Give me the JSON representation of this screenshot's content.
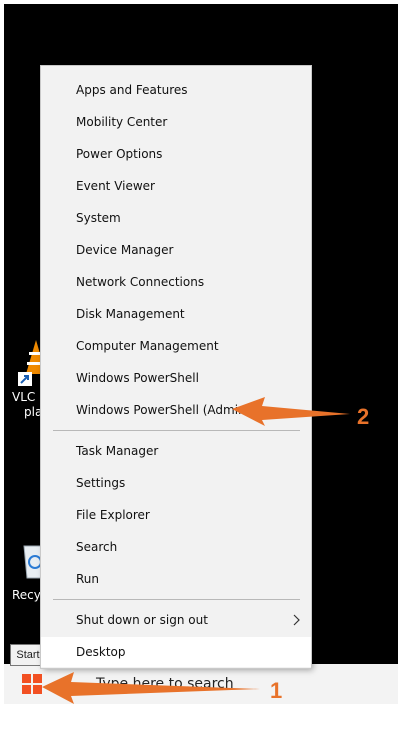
{
  "desktop": {
    "vlc_label_1": "VLC m",
    "vlc_label_2": "pla",
    "recycle_label": "Recyc"
  },
  "taskbar": {
    "search_placeholder": "Type here to search",
    "start_tooltip": "Start"
  },
  "menu": {
    "items": [
      {
        "label": "Apps and Features"
      },
      {
        "label": "Mobility Center"
      },
      {
        "label": "Power Options"
      },
      {
        "label": "Event Viewer"
      },
      {
        "label": "System"
      },
      {
        "label": "Device Manager"
      },
      {
        "label": "Network Connections"
      },
      {
        "label": "Disk Management"
      },
      {
        "label": "Computer Management"
      },
      {
        "label": "Windows PowerShell"
      },
      {
        "label": "Windows PowerShell (Admin)"
      },
      {
        "label": "Task Manager"
      },
      {
        "label": "Settings"
      },
      {
        "label": "File Explorer"
      },
      {
        "label": "Search"
      },
      {
        "label": "Run"
      },
      {
        "label": "Shut down or sign out"
      },
      {
        "label": "Desktop"
      }
    ]
  },
  "annotations": {
    "step1": "1",
    "step2": "2"
  },
  "colors": {
    "accent": "#e8722a",
    "windows_logo": "#f25022"
  }
}
